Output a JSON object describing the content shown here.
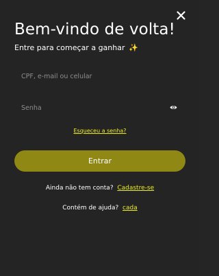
{
  "modal": {
    "title": "Bem-vindo de volta!",
    "subtitle": "Entre para começar a ganhar",
    "subtitle_emoji": "✨",
    "close_icon": "close-icon"
  },
  "form": {
    "identifier_placeholder": "CPF, e-mail ou celular",
    "password_placeholder": "Senha",
    "password_toggle_icon": "eye-icon",
    "forgot_password_label": "Esqueceu a senha?",
    "submit_label": "Entrar"
  },
  "footer": {
    "no_account_text": "Ainda não tem conta?",
    "register_link": "Cadastre-se",
    "help_text": "Contém de ajuda?",
    "help_link": "cada"
  },
  "colors": {
    "background": "#242424",
    "primary_button": "#8f8815",
    "link": "#eded1f",
    "text": "#ffffff",
    "placeholder": "#8d8d8d"
  }
}
